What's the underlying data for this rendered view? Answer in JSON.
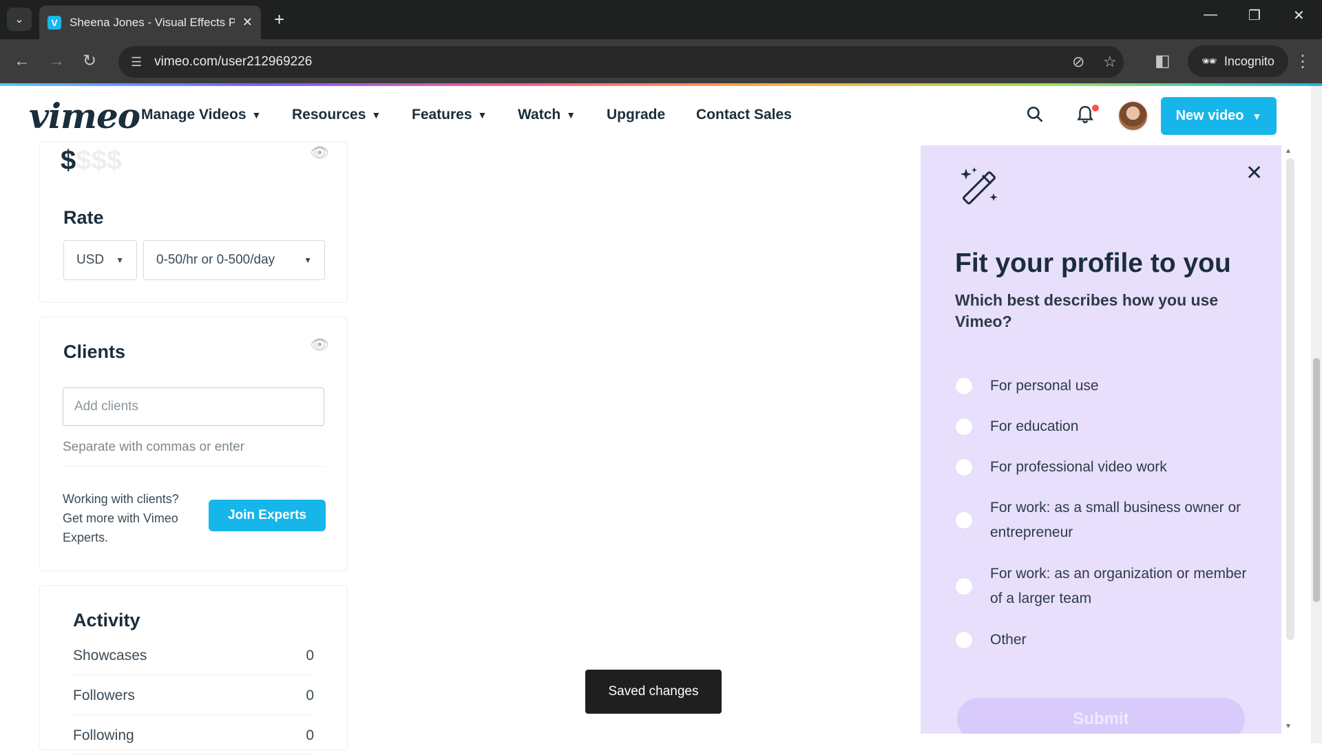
{
  "browser": {
    "tab_title": "Sheena Jones - Visual Effects Pr",
    "url": "vimeo.com/user212969226",
    "profile_label": "Incognito"
  },
  "nav": {
    "logo": "vimeo",
    "menu": [
      "Manage Videos",
      "Resources",
      "Features",
      "Watch",
      "Upgrade",
      "Contact Sales"
    ],
    "new_video_label": "New video"
  },
  "left": {
    "price_symbol": "$",
    "price_muted": "$$$",
    "rate": {
      "title": "Rate",
      "currency": "USD",
      "range": "0-50/hr or 0-500/day"
    },
    "clients": {
      "title": "Clients",
      "input_placeholder": "Add clients",
      "helper": "Separate with commas or enter",
      "promo_text": "Working with clients? Get more with Vimeo Experts.",
      "join_label": "Join Experts"
    },
    "activity": {
      "title": "Activity",
      "rows": [
        {
          "label": "Showcases",
          "value": "0"
        },
        {
          "label": "Followers",
          "value": "0"
        },
        {
          "label": "Following",
          "value": "0"
        }
      ]
    }
  },
  "toast": "Saved changes",
  "panel": {
    "title": "Fit your profile to you",
    "question": "Which best describes how you use Vimeo?",
    "options": [
      "For personal use",
      "For education",
      "For professional video work",
      "For work: as a small business owner or entrepreneur",
      "For work: as an organization or member of a larger team",
      "Other"
    ],
    "submit_label": "Submit"
  },
  "colors": {
    "brand_blue": "#17b6ea",
    "panel_bg": "#e8dffd",
    "text_dark": "#1a2e3b"
  }
}
